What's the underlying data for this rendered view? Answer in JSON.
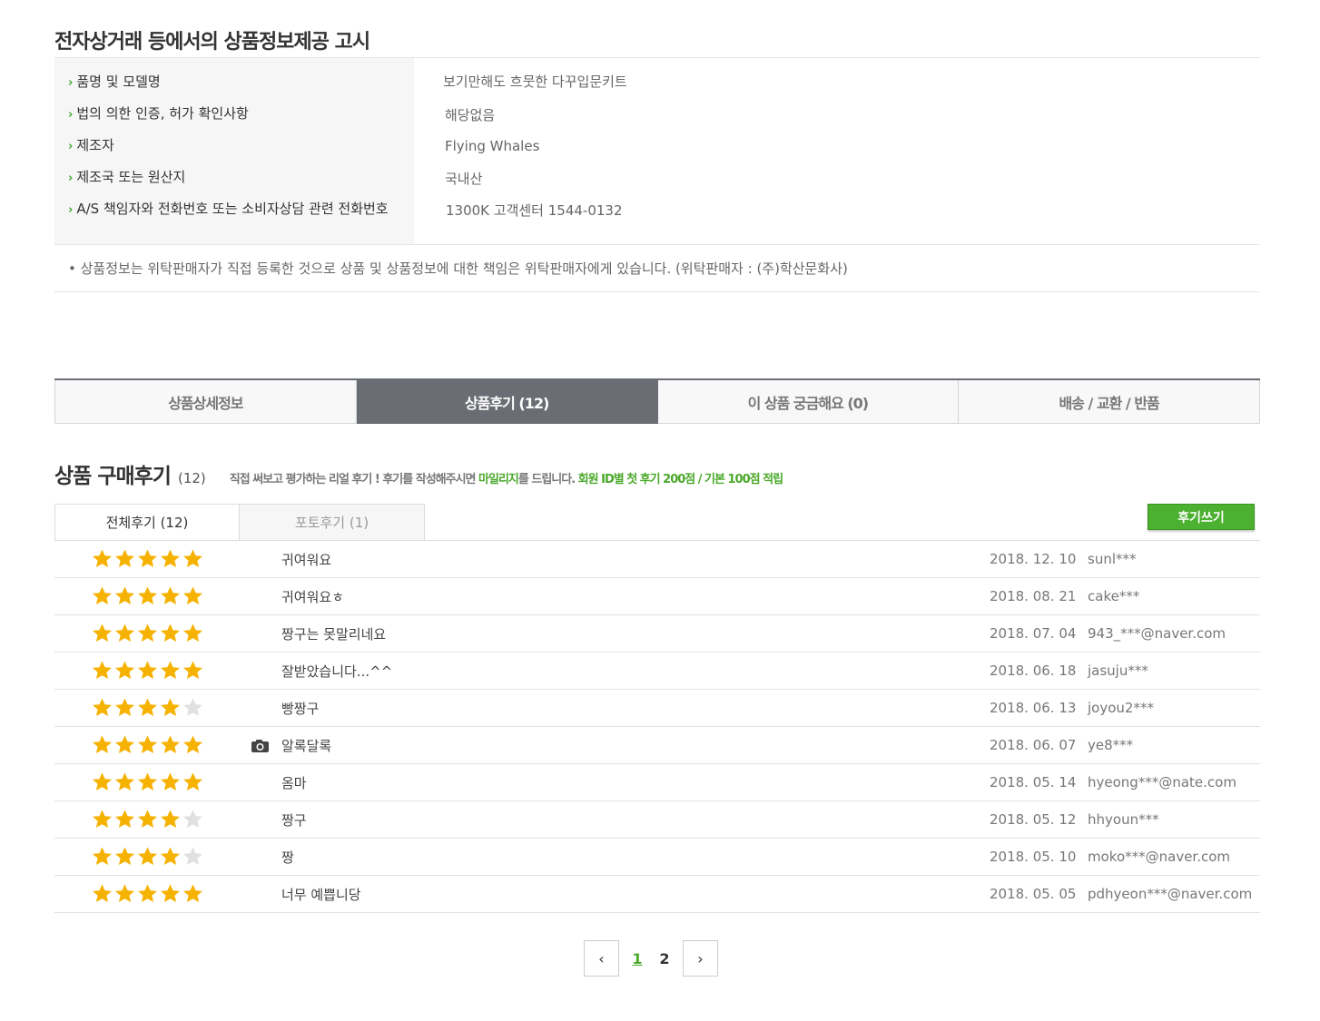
{
  "notice": {
    "title": "전자상거래 등에서의 상품정보제공 고시",
    "rows": [
      {
        "label": "품명 및 모델명",
        "value": "보기만해도 흐뭇한 다꾸입문키트"
      },
      {
        "label": "법의 의한 인증, 허가 확인사항",
        "value": "해당없음"
      },
      {
        "label": "제조자",
        "value": "Flying Whales"
      },
      {
        "label": "제조국 또는 원산지",
        "value": "국내산"
      },
      {
        "label": "A/S 책임자와 전화번호 또는 소비자상담 관련 전화번호",
        "value": "1300K 고객센터 1544-0132"
      }
    ],
    "footnote": "• 상품정보는 위탁판매자가 직접 등록한 것으로 상품 및 상품정보에 대한 책임은 위탁판매자에게 있습니다. (위탁판매자 : (주)학산문화사)"
  },
  "tabs": [
    {
      "label": "상품상세정보",
      "active": false
    },
    {
      "label": "상품후기 (12)",
      "active": true
    },
    {
      "label": "이 상품 궁금해요 (0)",
      "active": false
    },
    {
      "label": "배송 / 교환 / 반품",
      "active": false
    }
  ],
  "reviews": {
    "title": "상품 구매후기",
    "count": "(12)",
    "desc_part1": "직접 써보고 평가하는 리얼 후기 ! 후기를 작성해주시면 ",
    "desc_highlight1": "마일리지",
    "desc_part2": "를 드립니다. ",
    "desc_highlight2": "회원 ID별 첫 후기 200점 / 기본 100점 적립",
    "subtabs": [
      "전체후기 (12)",
      "포토후기 (1)"
    ],
    "write_label": "후기쓰기",
    "items": [
      {
        "rating": 5,
        "photo": false,
        "title": "귀여워요",
        "date": "2018. 12. 10",
        "user": "sunl***"
      },
      {
        "rating": 5,
        "photo": false,
        "title": "귀여워요ㅎ",
        "date": "2018. 08. 21",
        "user": "cake***"
      },
      {
        "rating": 5,
        "photo": false,
        "title": "짱구는 못말리네요",
        "date": "2018. 07. 04",
        "user": "943_***@naver.com"
      },
      {
        "rating": 5,
        "photo": false,
        "title": "잘받았습니다...^^",
        "date": "2018. 06. 18",
        "user": "jasuju***"
      },
      {
        "rating": 4,
        "photo": false,
        "title": "빵짱구",
        "date": "2018. 06. 13",
        "user": "joyou2***"
      },
      {
        "rating": 5,
        "photo": true,
        "title": "알록달록",
        "date": "2018. 06. 07",
        "user": "ye8***"
      },
      {
        "rating": 5,
        "photo": false,
        "title": "옴마",
        "date": "2018. 05. 14",
        "user": "hyeong***@nate.com"
      },
      {
        "rating": 4,
        "photo": false,
        "title": "짱구",
        "date": "2018. 05. 12",
        "user": "hhyoun***"
      },
      {
        "rating": 4,
        "photo": false,
        "title": "짱",
        "date": "2018. 05. 10",
        "user": "moko***@naver.com"
      },
      {
        "rating": 5,
        "photo": false,
        "title": "너무 예쁩니당",
        "date": "2018. 05. 05",
        "user": "pdhyeon***@naver.com"
      }
    ]
  },
  "pagination": {
    "prev_icon": "‹",
    "next_icon": "›",
    "pages": [
      "1",
      "2"
    ],
    "current": "1"
  },
  "colors": {
    "accent_green": "#4aa82a",
    "star_on": "#f6b200",
    "star_off": "#e0e0e0",
    "tab_active": "#6a6d73"
  }
}
